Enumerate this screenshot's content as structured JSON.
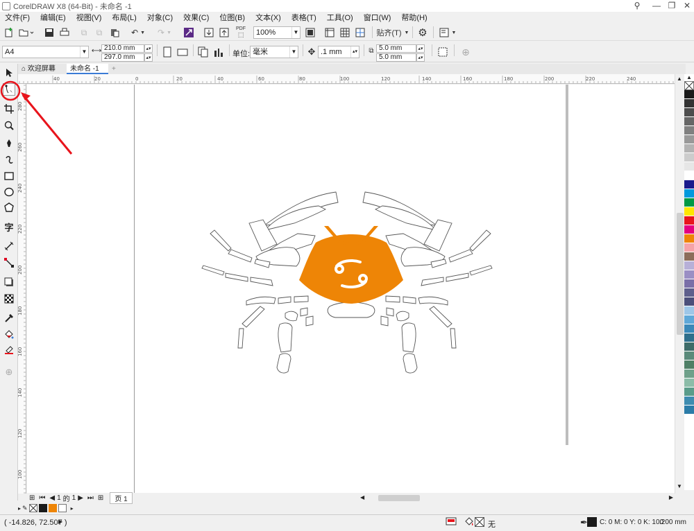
{
  "window": {
    "title": "CorelDRAW X8 (64-Bit) - 未命名 -1"
  },
  "menu": [
    "文件(F)",
    "编辑(E)",
    "视图(V)",
    "布局(L)",
    "对象(C)",
    "效果(C)",
    "位图(B)",
    "文本(X)",
    "表格(T)",
    "工具(O)",
    "窗口(W)",
    "帮助(H)"
  ],
  "toolbar": {
    "zoom": "100%",
    "snap_label": "贴齐(T)",
    "pdf_label": "PDF"
  },
  "property_bar": {
    "page_size": "A4",
    "width": "210.0 mm",
    "height": "297.0 mm",
    "unit_label": "单位:",
    "unit": "毫米",
    "nudge": ".1 mm",
    "dup_x": "5.0 mm",
    "dup_y": "5.0 mm"
  },
  "tabs": {
    "welcome": "欢迎屏幕",
    "document": "未命名 -1",
    "add": "+"
  },
  "ruler": {
    "h_labels": [
      "40",
      "20",
      "0",
      "20",
      "40",
      "60",
      "80",
      "100",
      "120",
      "140",
      "160",
      "180",
      "200",
      "220",
      "240"
    ],
    "v_labels": [
      "280",
      "260",
      "240",
      "220",
      "200",
      "180",
      "160",
      "140",
      "120",
      "100"
    ]
  },
  "page_nav": {
    "current": "1",
    "of": "的",
    "total": "1",
    "page_tab": "页 1"
  },
  "status": {
    "coords": "( -14.826, 72.507 )",
    "fill_none": "无",
    "outline_color": "C: 0 M: 0 Y: 0 K: 100",
    "outline_width": ".200 mm"
  },
  "colors": {
    "crab_fill": "#ee8506",
    "annotation_red": "#e8141c",
    "palette": [
      "#1a1a1a",
      "#333333",
      "#4d4d4d",
      "#666666",
      "#808080",
      "#999999",
      "#b3b3b3",
      "#cccccc",
      "#e6e6e6",
      "#ffffff",
      "#1a1a8c",
      "#0099dd",
      "#009944",
      "#ffe600",
      "#e8141c",
      "#e4007f",
      "#ee8506",
      "#f5a3a8",
      "#8c6d5a",
      "#b7b0d8",
      "#9a8fc4",
      "#7a6fa8",
      "#5e5f8c",
      "#4b4f7a",
      "#9ec7e8",
      "#5fa8d8",
      "#3a88b8",
      "#2f6f8c",
      "#3d6b68",
      "#5a8a7a",
      "#4f7f66",
      "#6fa08a",
      "#8cbca8",
      "#5a9c8a",
      "#3e8cb0",
      "#2b7ca8"
    ]
  },
  "icons": [
    "arrow-pointer-icon",
    "shape-tool-icon",
    "crop-icon",
    "zoom-icon",
    "freehand-icon",
    "artistic-media-icon",
    "rectangle-icon",
    "ellipse-icon",
    "polygon-icon",
    "text-icon",
    "parallel-dimension-icon",
    "connector-icon",
    "drop-shadow-icon",
    "transparency-icon",
    "eyedropper-icon",
    "interactive-fill-icon",
    "smart-fill-icon",
    "add-tool-icon"
  ]
}
